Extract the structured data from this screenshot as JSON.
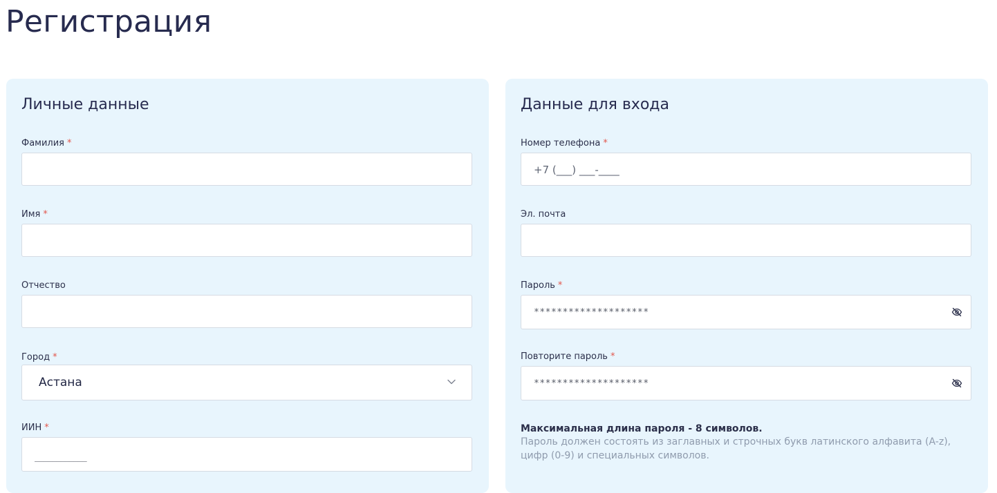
{
  "page": {
    "title": "Регистрация"
  },
  "personal": {
    "title": "Личные данные",
    "last_name": {
      "label": "Фамилия",
      "required": "*",
      "value": ""
    },
    "first_name": {
      "label": "Имя",
      "required": "*",
      "value": ""
    },
    "middle_name": {
      "label": "Отчество",
      "value": ""
    },
    "city": {
      "label": "Город",
      "required": "*",
      "selected": "Астана"
    },
    "iin": {
      "label": "ИИН",
      "required": "*",
      "mask": "____________"
    }
  },
  "login": {
    "title": "Данные для входа",
    "phone": {
      "label": "Номер телефона",
      "required": "*",
      "placeholder": "+7 (___) ___-____"
    },
    "email": {
      "label": "Эл. почта",
      "value": ""
    },
    "password": {
      "label": "Пароль",
      "required": "*",
      "value": "********************"
    },
    "password_repeat": {
      "label": "Повторите пароль",
      "required": "*",
      "value": "********************"
    },
    "hint_title": "Максимальная длина пароля - 8 символов.",
    "hint_text": "Пароль должен состоять из заглавных и строчных букв латинского алфавита (A-z), цифр (0-9) и специальных символов."
  },
  "icons": {
    "select_arrow": "chevron-down-icon",
    "password_toggle": "eye-off-icon"
  },
  "colors": {
    "panel_background": "#e8f5fd",
    "required_asterisk": "#e2574c",
    "title_text": "#272b4f",
    "hint_text": "#8f9bad"
  }
}
